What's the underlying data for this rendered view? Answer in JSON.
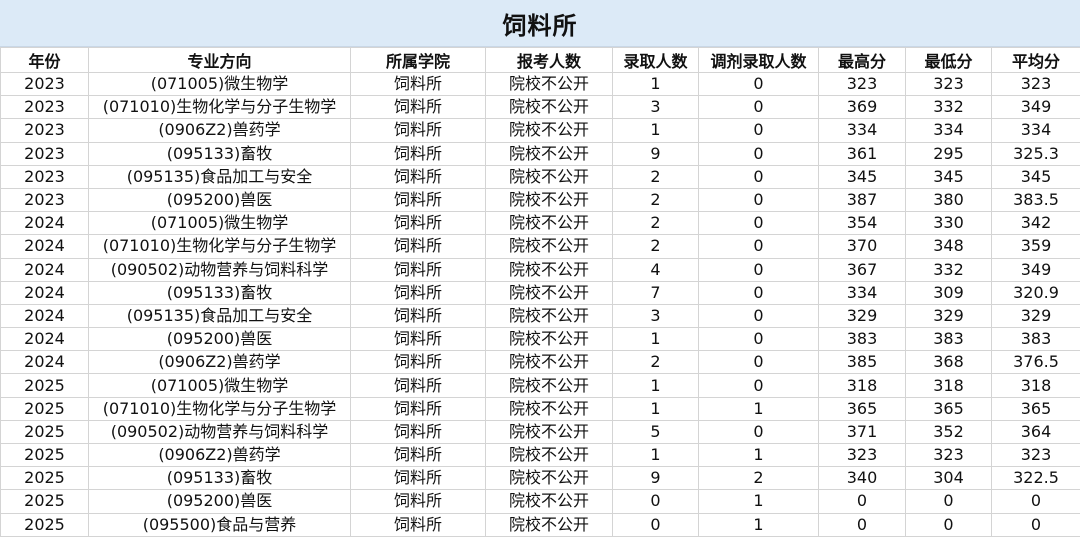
{
  "title": "饲料所",
  "columns": [
    "年份",
    "专业方向",
    "所属学院",
    "报考人数",
    "录取人数",
    "调剂录取人数",
    "最高分",
    "最低分",
    "平均分"
  ],
  "rows": [
    [
      "2023",
      "(071005)微生物学",
      "饲料所",
      "院校不公开",
      "1",
      "0",
      "323",
      "323",
      "323"
    ],
    [
      "2023",
      "(071010)生物化学与分子生物学",
      "饲料所",
      "院校不公开",
      "3",
      "0",
      "369",
      "332",
      "349"
    ],
    [
      "2023",
      "(0906Z2)兽药学",
      "饲料所",
      "院校不公开",
      "1",
      "0",
      "334",
      "334",
      "334"
    ],
    [
      "2023",
      "(095133)畜牧",
      "饲料所",
      "院校不公开",
      "9",
      "0",
      "361",
      "295",
      "325.3"
    ],
    [
      "2023",
      "(095135)食品加工与安全",
      "饲料所",
      "院校不公开",
      "2",
      "0",
      "345",
      "345",
      "345"
    ],
    [
      "2023",
      "(095200)兽医",
      "饲料所",
      "院校不公开",
      "2",
      "0",
      "387",
      "380",
      "383.5"
    ],
    [
      "2024",
      "(071005)微生物学",
      "饲料所",
      "院校不公开",
      "2",
      "0",
      "354",
      "330",
      "342"
    ],
    [
      "2024",
      "(071010)生物化学与分子生物学",
      "饲料所",
      "院校不公开",
      "2",
      "0",
      "370",
      "348",
      "359"
    ],
    [
      "2024",
      "(090502)动物营养与饲料科学",
      "饲料所",
      "院校不公开",
      "4",
      "0",
      "367",
      "332",
      "349"
    ],
    [
      "2024",
      "(095133)畜牧",
      "饲料所",
      "院校不公开",
      "7",
      "0",
      "334",
      "309",
      "320.9"
    ],
    [
      "2024",
      "(095135)食品加工与安全",
      "饲料所",
      "院校不公开",
      "3",
      "0",
      "329",
      "329",
      "329"
    ],
    [
      "2024",
      "(095200)兽医",
      "饲料所",
      "院校不公开",
      "1",
      "0",
      "383",
      "383",
      "383"
    ],
    [
      "2024",
      "(0906Z2)兽药学",
      "饲料所",
      "院校不公开",
      "2",
      "0",
      "385",
      "368",
      "376.5"
    ],
    [
      "2025",
      "(071005)微生物学",
      "饲料所",
      "院校不公开",
      "1",
      "0",
      "318",
      "318",
      "318"
    ],
    [
      "2025",
      "(071010)生物化学与分子生物学",
      "饲料所",
      "院校不公开",
      "1",
      "1",
      "365",
      "365",
      "365"
    ],
    [
      "2025",
      "(090502)动物营养与饲料科学",
      "饲料所",
      "院校不公开",
      "5",
      "0",
      "371",
      "352",
      "364"
    ],
    [
      "2025",
      "(0906Z2)兽药学",
      "饲料所",
      "院校不公开",
      "1",
      "1",
      "323",
      "323",
      "323"
    ],
    [
      "2025",
      "(095133)畜牧",
      "饲料所",
      "院校不公开",
      "9",
      "2",
      "340",
      "304",
      "322.5"
    ],
    [
      "2025",
      "(095200)兽医",
      "饲料所",
      "院校不公开",
      "0",
      "1",
      "0",
      "0",
      "0"
    ],
    [
      "2025",
      "(095500)食品与营养",
      "饲料所",
      "院校不公开",
      "0",
      "1",
      "0",
      "0",
      "0"
    ]
  ]
}
